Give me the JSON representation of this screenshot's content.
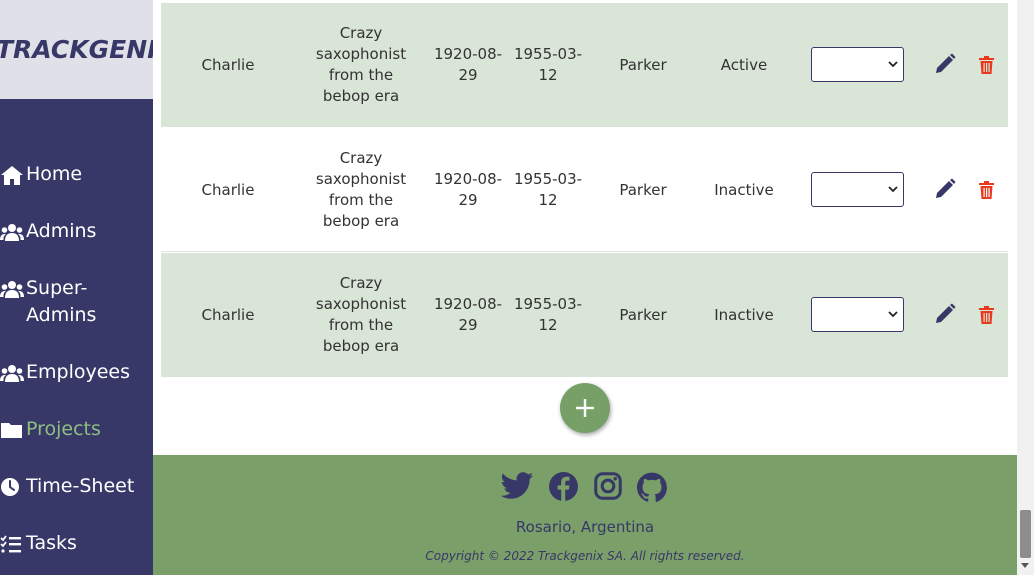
{
  "brand": {
    "logo_text": "TRACKGENIX"
  },
  "sidebar": {
    "items": [
      {
        "label": "Home",
        "icon": "home-icon"
      },
      {
        "label": "Admins",
        "icon": "users-icon"
      },
      {
        "label": "Super-Admins",
        "icon": "users-icon"
      },
      {
        "label": "Employees",
        "icon": "users-icon"
      },
      {
        "label": "Projects",
        "icon": "folder-icon",
        "active": true
      },
      {
        "label": "Time-Sheet",
        "icon": "clock-icon"
      },
      {
        "label": "Tasks",
        "icon": "task-list-icon"
      }
    ]
  },
  "table": {
    "rows": [
      {
        "name": "Charlie",
        "description": "Crazy saxophonist from the bebop era",
        "start_date": "1920-08-29",
        "end_date": "1955-03-12",
        "last_name": "Parker",
        "status": "Active",
        "select_value": ""
      },
      {
        "name": "Charlie",
        "description": "Crazy saxophonist from the bebop era",
        "start_date": "1920-08-29",
        "end_date": "1955-03-12",
        "last_name": "Parker",
        "status": "Inactive",
        "select_value": ""
      },
      {
        "name": "Charlie",
        "description": "Crazy saxophonist from the bebop era",
        "start_date": "1920-08-29",
        "end_date": "1955-03-12",
        "last_name": "Parker",
        "status": "Inactive",
        "select_value": ""
      }
    ]
  },
  "actions": {
    "add_icon": "plus-icon"
  },
  "footer": {
    "social_icons": [
      "twitter-icon",
      "facebook-icon",
      "instagram-icon",
      "github-icon"
    ],
    "location": "Rosario, Argentina",
    "copyright": "Copyright © 2022 Trackgenix SA. All rights reserved."
  },
  "colors": {
    "primary": "#373867",
    "accent_green": "#77a068",
    "footer_green": "#7a9f69",
    "row_shade": "#d9e5d6",
    "delete_red": "#e8391f"
  }
}
